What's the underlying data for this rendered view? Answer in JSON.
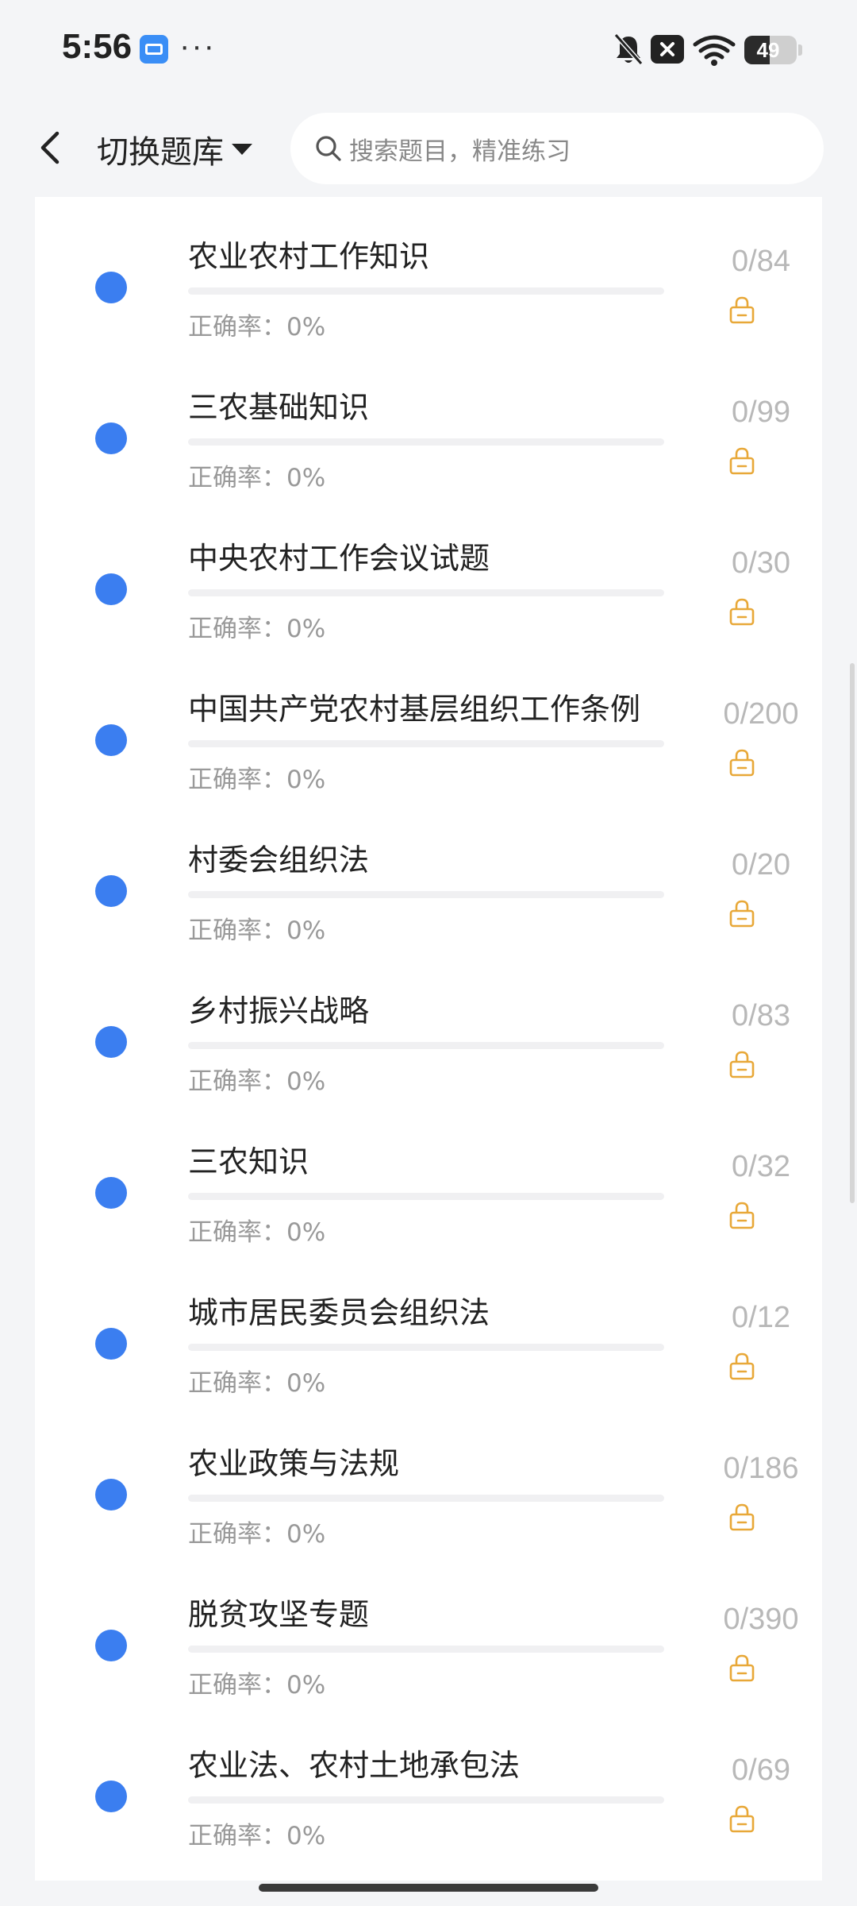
{
  "status_bar": {
    "time": "5:56",
    "more": "···",
    "battery_level": "49",
    "battery_fraction": 0.49,
    "icons": [
      "app-notification-icon",
      "mute-bell-icon",
      "notification-x-icon",
      "wifi-icon",
      "battery-icon"
    ]
  },
  "header": {
    "back_icon": "chevron-left-icon",
    "switch_label": "切换题库",
    "search_placeholder": "搜索题目，精准练习"
  },
  "accuracy_label": "正确率：",
  "items": [
    {
      "title": "农业农村工作知识",
      "accuracy": "0%",
      "count": "0/84",
      "progress": 0
    },
    {
      "title": "三农基础知识",
      "accuracy": "0%",
      "count": "0/99",
      "progress": 0
    },
    {
      "title": "中央农村工作会议试题",
      "accuracy": "0%",
      "count": "0/30",
      "progress": 0
    },
    {
      "title": "中国共产党农村基层组织工作条例",
      "accuracy": "0%",
      "count": "0/200",
      "progress": 0
    },
    {
      "title": "村委会组织法",
      "accuracy": "0%",
      "count": "0/20",
      "progress": 0
    },
    {
      "title": "乡村振兴战略",
      "accuracy": "0%",
      "count": "0/83",
      "progress": 0
    },
    {
      "title": "三农知识",
      "accuracy": "0%",
      "count": "0/32",
      "progress": 0
    },
    {
      "title": "城市居民委员会组织法",
      "accuracy": "0%",
      "count": "0/12",
      "progress": 0
    },
    {
      "title": "农业政策与法规",
      "accuracy": "0%",
      "count": "0/186",
      "progress": 0
    },
    {
      "title": "脱贫攻坚专题",
      "accuracy": "0%",
      "count": "0/390",
      "progress": 0
    },
    {
      "title": "农业法、农村土地承包法",
      "accuracy": "0%",
      "count": "0/69",
      "progress": 0
    }
  ],
  "colors": {
    "accent": "#3b7ef0",
    "lock": "#e8a838",
    "muted_text": "#999999",
    "count_text": "#b8b8b8"
  }
}
